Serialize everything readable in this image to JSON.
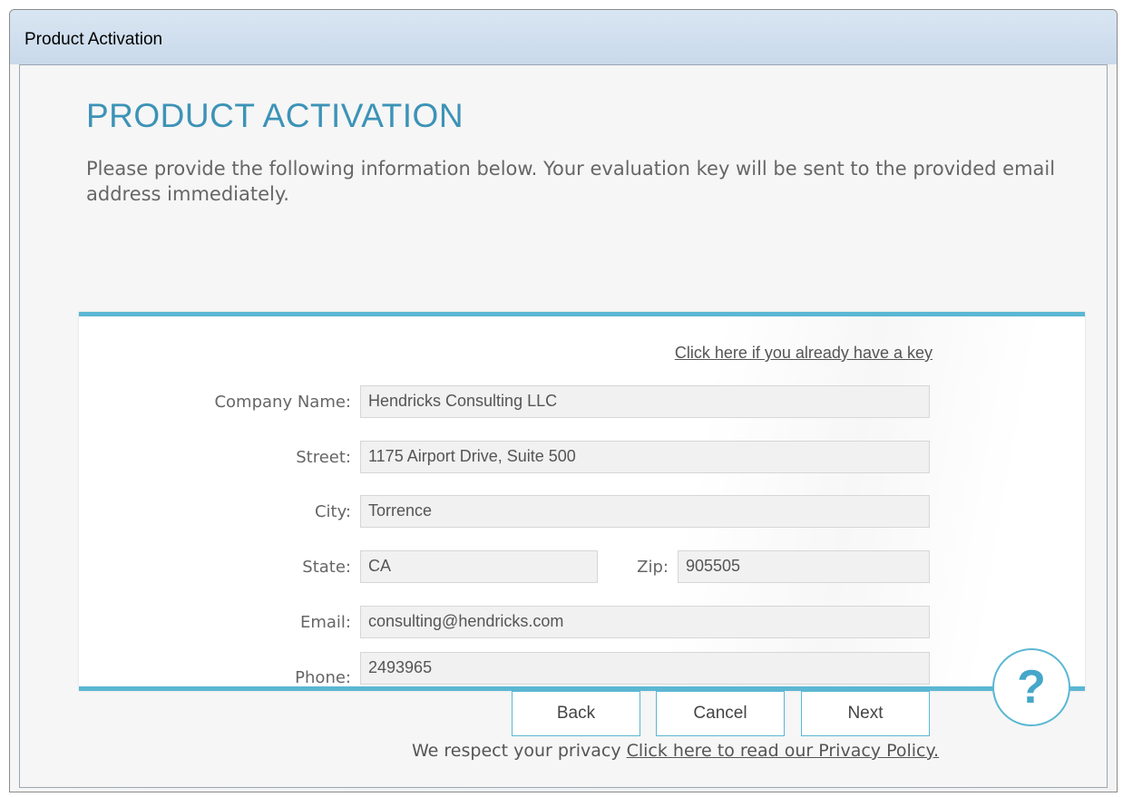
{
  "window": {
    "title": "Product Activation"
  },
  "page": {
    "heading": "PRODUCT ACTIVATION",
    "intro": "Please provide the following information below. Your evaluation key will be sent to the provided email address immediately."
  },
  "form": {
    "existing_key_link": "Click here if you already have a key",
    "company": {
      "label": "Company Name:",
      "value": "Hendricks Consulting LLC"
    },
    "street": {
      "label": "Street:",
      "value": "1175 Airport Drive, Suite 500"
    },
    "city": {
      "label": "City:",
      "value": "Torrence"
    },
    "state": {
      "label": "State:",
      "value": "CA"
    },
    "zip": {
      "label": "Zip:",
      "value": "905505"
    },
    "email": {
      "label": "Email:",
      "value": "consulting@hendricks.com"
    },
    "phone": {
      "label": "Phone:",
      "value": "2493965"
    }
  },
  "buttons": {
    "back": "Back",
    "cancel": "Cancel",
    "next": "Next",
    "help": "?"
  },
  "footer": {
    "text": "We respect your privacy",
    "link": "Click here to read our Privacy Policy."
  },
  "colors": {
    "accent": "#5ab7d3",
    "heading": "#3c93b7"
  }
}
